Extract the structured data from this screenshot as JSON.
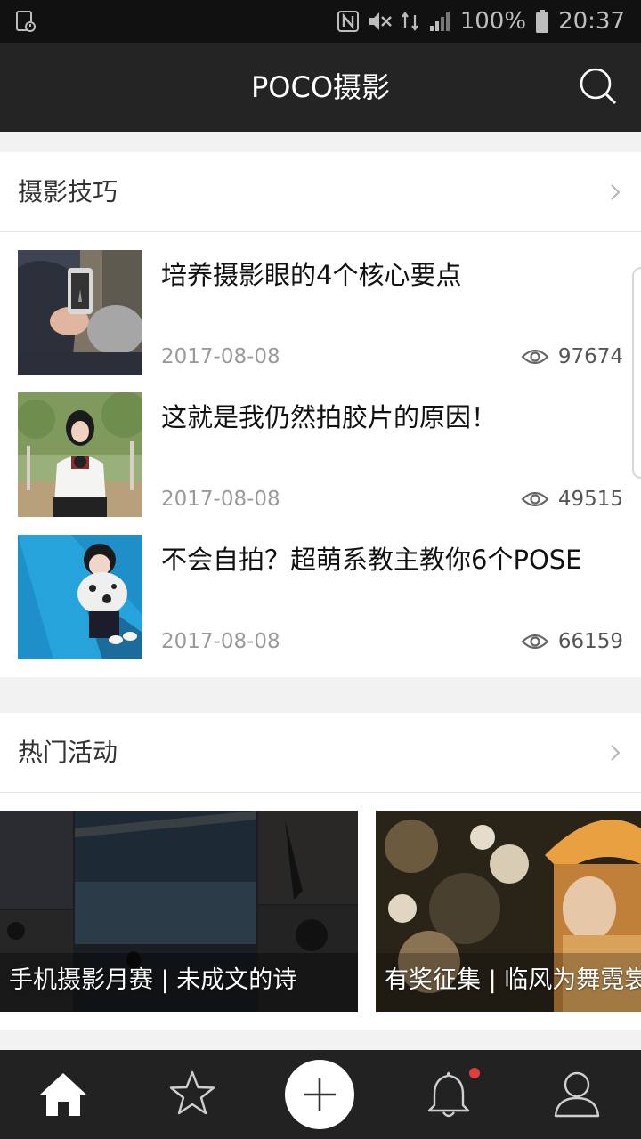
{
  "status_bar": {
    "battery": "100%",
    "time": "20:37"
  },
  "app_bar": {
    "title": "POCO摄影",
    "search_icon": "search-icon"
  },
  "tips_section": {
    "title": "摄影技巧",
    "articles": [
      {
        "title": "培养摄影眼的4个核心要点",
        "date": "2017-08-08",
        "views": "97674"
      },
      {
        "title": "这就是我仍然拍胶片的原因！",
        "date": "2017-08-08",
        "views": "49515"
      },
      {
        "title": "不会自拍？超萌系教主教你6个POSE",
        "date": "2017-08-08",
        "views": "66159"
      }
    ]
  },
  "events_section": {
    "title": "热门活动",
    "banners": [
      {
        "caption": "手机摄影月赛 | 未成文的诗"
      },
      {
        "caption": "有奖征集 | 临风为舞霓裳"
      }
    ]
  },
  "tab_bar": {
    "items": [
      "home-icon",
      "star-icon",
      "plus-icon",
      "bell-icon",
      "user-icon"
    ],
    "notification_color": "#e43c3c"
  }
}
